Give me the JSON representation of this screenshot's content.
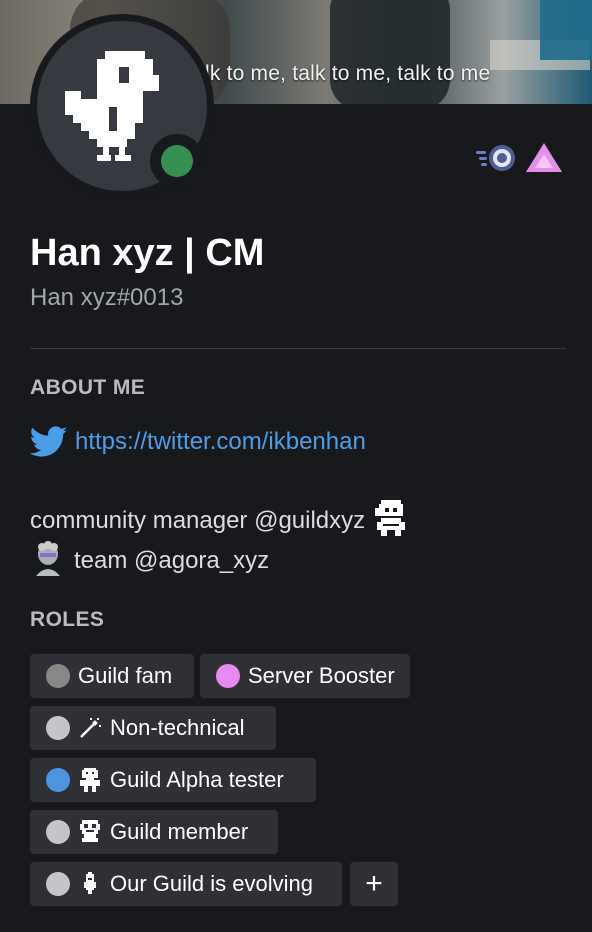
{
  "banner": {
    "caption": "lk to me, talk to me, talk to me"
  },
  "profile": {
    "display_name": "Han xyz | CM",
    "username": "Han xyz#0013",
    "status_color": "#3ba55d",
    "status": "online"
  },
  "badges": [
    {
      "icon": "server-boost-badge-icon"
    },
    {
      "icon": "triangle-badge-icon",
      "color": "#e58ee7"
    }
  ],
  "about_me": {
    "header": "ABOUT ME",
    "link_icon": "twitter-icon",
    "link_text": "https://twitter.com/ikbenhan",
    "bio_line_1": "community manager @guildxyz",
    "bio_line_1_emoji": "robot-emoji",
    "bio_line_2": "team @agora_xyz",
    "bio_line_2_emoji": "statue-emoji"
  },
  "roles": {
    "header": "ROLES",
    "items": [
      {
        "label": "Guild fam",
        "color": "#888888"
      },
      {
        "label": "Server Booster",
        "color": "#e78bf0"
      },
      {
        "label": "Non-technical",
        "color": "#c4c5c8",
        "icon": "magic-wand-icon"
      },
      {
        "label": "Guild Alpha tester",
        "color": "#4f94dc",
        "icon": "alpha-robot-icon"
      },
      {
        "label": "Guild member",
        "color": "#c4c5c8",
        "icon": "guild-member-icon"
      },
      {
        "label": "Our Guild is evolving",
        "color": "#c4c5c8",
        "icon": "rocket-icon"
      }
    ],
    "add_label": "+"
  }
}
